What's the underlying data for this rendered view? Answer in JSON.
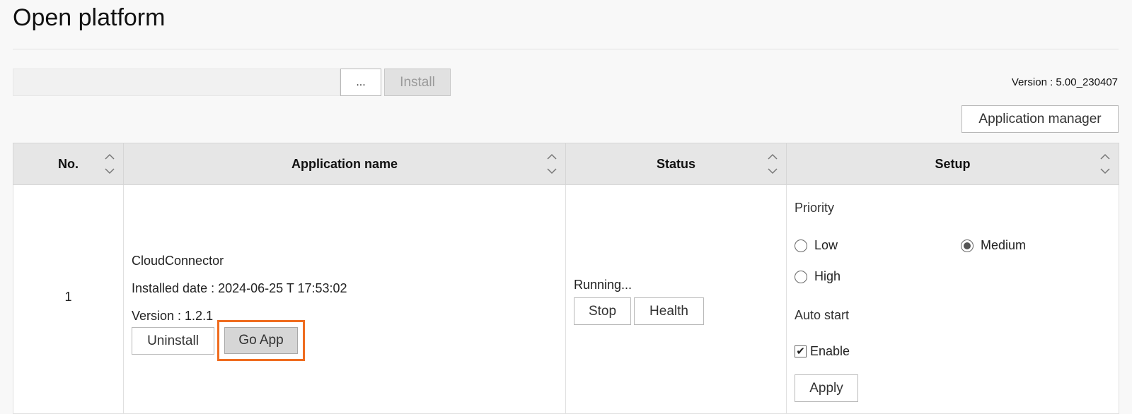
{
  "page": {
    "title": "Open platform"
  },
  "toolbar": {
    "file_value": "",
    "browse_label": "...",
    "install_label": "Install",
    "version_text": "Version : 5.00_230407",
    "app_manager_label": "Application manager"
  },
  "table": {
    "headers": [
      "No.",
      "Application name",
      "Status",
      "Setup"
    ],
    "rows": [
      {
        "no": "1",
        "app_name": "CloudConnector",
        "installed": "Installed date : 2024-06-25 T 17:53:02",
        "version": "Version : 1.2.1",
        "uninstall_label": "Uninstall",
        "goapp_label": "Go App",
        "status": "Running...",
        "stop_label": "Stop",
        "health_label": "Health",
        "setup": {
          "priority_label": "Priority",
          "priority_options": [
            "Low",
            "Medium",
            "High"
          ],
          "priority_selected": "Medium",
          "auto_start_label": "Auto start",
          "enable_label": "Enable",
          "enable_checked": true,
          "apply_label": "Apply"
        }
      }
    ]
  },
  "colors": {
    "highlight": "#ef6c1f",
    "header_bg": "#e6e6e6"
  }
}
